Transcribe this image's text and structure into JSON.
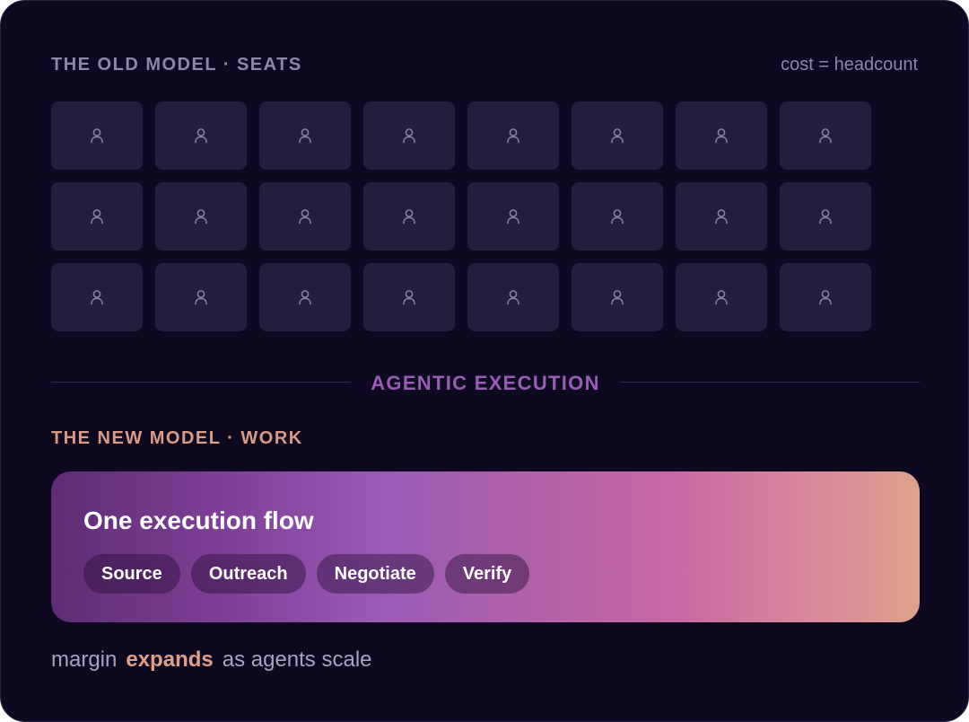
{
  "old_model": {
    "title": "THE OLD MODEL · SEATS",
    "cost_note": "cost = headcount",
    "seat_icon": "person-icon",
    "seat_count": 24
  },
  "divider": {
    "label": "AGENTIC EXECUTION"
  },
  "new_model": {
    "title": "THE NEW MODEL · WORK",
    "flow_title": "One execution flow",
    "steps": [
      "Source",
      "Outreach",
      "Negotiate",
      "Verify"
    ]
  },
  "footer": {
    "prefix": "margin",
    "highlight": "expands",
    "suffix": "as agents scale"
  },
  "colors": {
    "background": "#0e0920",
    "seat": "#241d3b",
    "divider_accent": "#9a5db4",
    "new_accent": "#d99a86"
  }
}
